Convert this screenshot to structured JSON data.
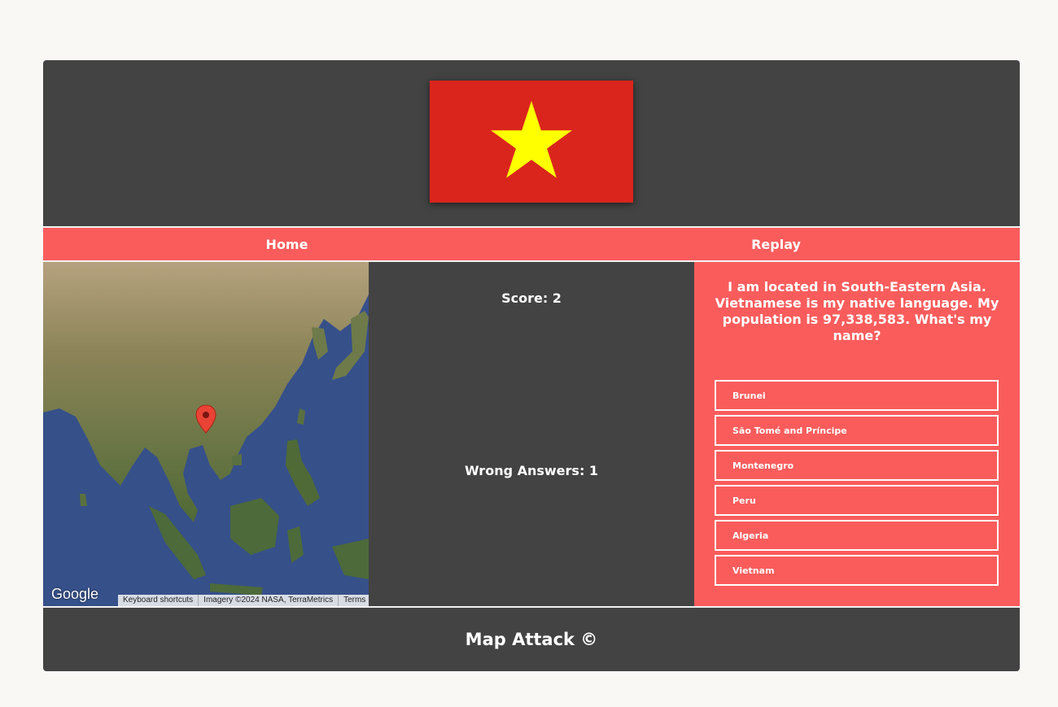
{
  "flag": {
    "country_alt": "Vietnam flag",
    "background_color": "#da251d",
    "star_color": "#ffff00"
  },
  "nav": {
    "home_label": "Home",
    "replay_label": "Replay"
  },
  "map": {
    "marker_icon": "map-pin-icon",
    "logo_text": "Google",
    "attribution": {
      "shortcuts": "Keyboard shortcuts",
      "imagery": "Imagery ©2024 NASA, TerraMetrics",
      "terms": "Terms"
    }
  },
  "stats": {
    "score": "Score: 2",
    "wrong_answers": "Wrong Answers: 1"
  },
  "question": {
    "text": "I am located in South-Eastern Asia. Vietnamese is my native language. My population is 97,338,583. What's my name?",
    "options": [
      "Brunei",
      "São Tomé and Príncipe",
      "Montenegro",
      "Peru",
      "Algeria",
      "Vietnam"
    ]
  },
  "footer": {
    "text": "Map Attack ©"
  },
  "colors": {
    "accent": "#fa5c5c",
    "panel": "#434343",
    "page_background": "#f9f8f5"
  }
}
